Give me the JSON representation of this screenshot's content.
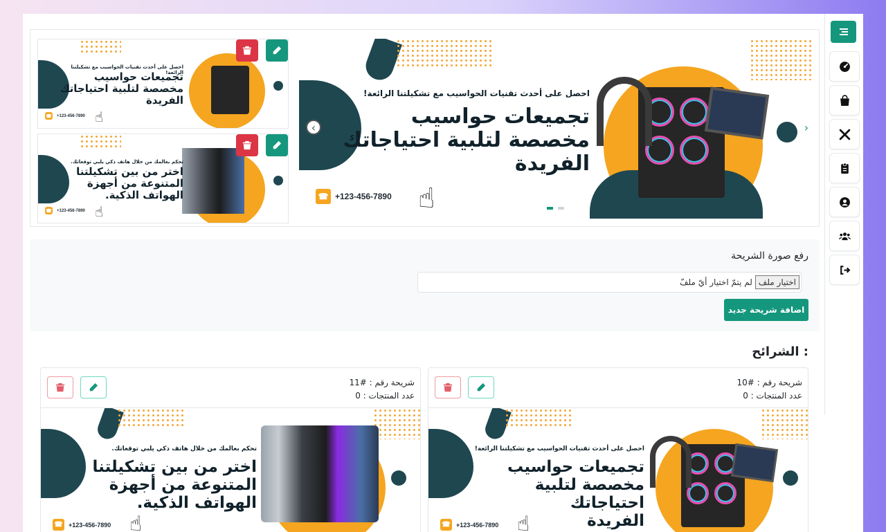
{
  "sidebar": {
    "items": [
      {
        "name": "dashboard-icon"
      },
      {
        "name": "shopping-bag-icon"
      },
      {
        "name": "tools-icon"
      },
      {
        "name": "clipboard-icon"
      },
      {
        "name": "user-icon"
      },
      {
        "name": "users-icon"
      },
      {
        "name": "logout-icon"
      }
    ]
  },
  "slides": {
    "computers": {
      "subtitle": "احصل على أحدث تقنيات الحواسيب مع تشكيلتنا الرائعة!",
      "line1": "تجميعات حواسيب",
      "line2": "مخصصة لتلبية احتياجاتك",
      "line3": "الفريدة",
      "phone": "+123-456-7890"
    },
    "phones": {
      "subtitle": "تحكم بعالمك من خلال هاتف ذكي يلبي توقعاتك.",
      "line1": "اختر من بين تشكيلتنا",
      "line2": "المتنوعة من أجهزة",
      "line3": "الهواتف الذكية.",
      "phone": "+123-456-7890"
    }
  },
  "upload": {
    "label": "رفع صورة الشريحة",
    "choose_button": "اختيار ملف",
    "no_file_text": "لم يتمّ اختيار أيّ ملفّ",
    "submit": "اضافة شريحة جديد"
  },
  "slides_section": {
    "title": "الشرائح :",
    "cards": [
      {
        "number": "شريحة رقم : #10",
        "products": "عدد المنتجات : 0"
      },
      {
        "number": "شريحة رقم : #11",
        "products": "عدد المنتجات : 0"
      }
    ]
  },
  "colors": {
    "accent": "#14977d",
    "danger": "#dc3545",
    "navy": "#1f4750",
    "orange": "#f5a51f"
  }
}
